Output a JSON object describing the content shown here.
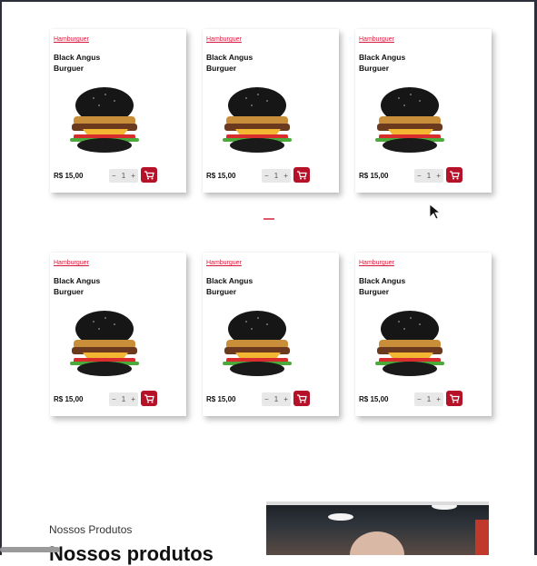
{
  "products": [
    {
      "category": "Hamburguer",
      "name": "Black Angus Burguer",
      "price": "R$ 15,00",
      "qty": "1"
    },
    {
      "category": "Hamburguer",
      "name": "Black Angus Burguer",
      "price": "R$ 15,00",
      "qty": "1"
    },
    {
      "category": "Hamburguer",
      "name": "Black Angus Burguer",
      "price": "R$ 15,00",
      "qty": "1"
    },
    {
      "category": "Hamburguer",
      "name": "Black Angus Burguer",
      "price": "R$ 15,00",
      "qty": "1"
    },
    {
      "category": "Hamburguer",
      "name": "Black Angus Burguer",
      "price": "R$ 15,00",
      "qty": "1"
    },
    {
      "category": "Hamburguer",
      "name": "Black Angus Burguer",
      "price": "R$ 15,00",
      "qty": "1"
    }
  ],
  "stepper": {
    "minus": "−",
    "plus": "+"
  },
  "section": {
    "subtitle": "Nossos Produtos",
    "title": "Nossos produtos"
  },
  "colors": {
    "accent": "#b5122a",
    "category": "#d6193b"
  },
  "icons": {
    "cart": "cart-icon",
    "cursor": "cursor-icon"
  }
}
